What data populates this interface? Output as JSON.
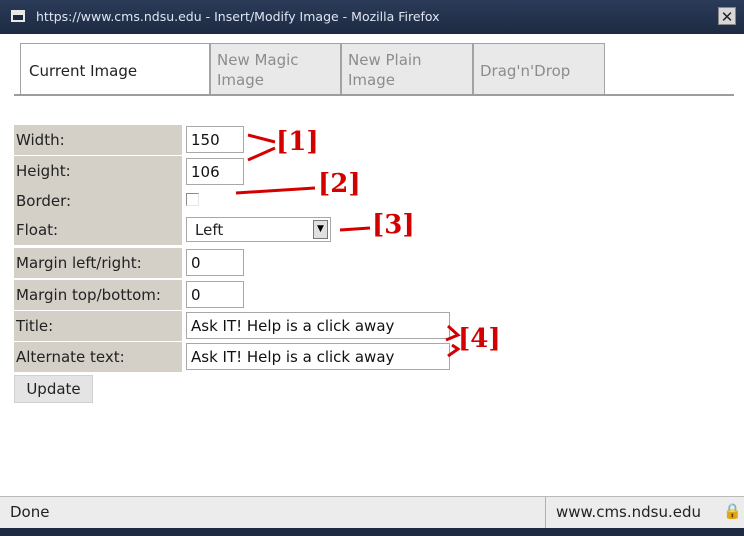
{
  "window": {
    "title": "https://www.cms.ndsu.edu - Insert/Modify Image - Mozilla Firefox",
    "close_glyph": "✕",
    "icon": "window-icon"
  },
  "tabs": [
    {
      "label": "Current Image",
      "active": true
    },
    {
      "label": "New Magic Image",
      "active": false
    },
    {
      "label": "New Plain Image",
      "active": false
    },
    {
      "label": "Drag'n'Drop",
      "active": false
    }
  ],
  "form": {
    "width": {
      "label": "Width:",
      "value": "150"
    },
    "height": {
      "label": "Height:",
      "value": "106"
    },
    "border": {
      "label": "Border:",
      "checked": false
    },
    "float": {
      "label": "Float:",
      "value": "Left"
    },
    "margin_lr": {
      "label": "Margin left/right:",
      "value": "0"
    },
    "margin_tb": {
      "label": "Margin top/bottom:",
      "value": "0"
    },
    "title": {
      "label": "Title:",
      "value": "Ask IT! Help is a click away"
    },
    "alt": {
      "label": "Alternate text:",
      "value": "Ask IT! Help is a click away"
    },
    "update_label": "Update"
  },
  "annotations": {
    "a1": "[1]",
    "a2": "[2]",
    "a3": "[3]",
    "a4": "[4]",
    "color": "#d30000"
  },
  "status": {
    "left": "Done",
    "right": "www.cms.ndsu.edu",
    "lock_icon": "lock-icon"
  }
}
